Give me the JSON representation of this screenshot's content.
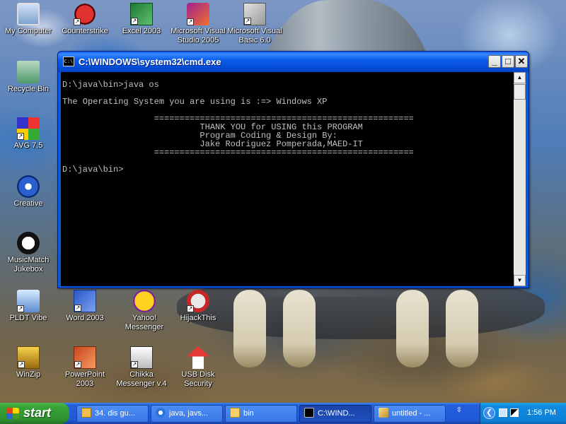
{
  "desktop": {
    "icons": [
      {
        "label": "My Computer",
        "icon": "my-computer-icon"
      },
      {
        "label": "Counterstrike",
        "icon": "counterstrike-icon"
      },
      {
        "label": "Excel 2003",
        "icon": "excel-icon"
      },
      {
        "label": "Microsoft Visual Studio 2005",
        "icon": "visual-studio-icon"
      },
      {
        "label": "Microsoft Visual Basic 6.0",
        "icon": "visual-basic-icon"
      },
      {
        "label": "Recycle Bin",
        "icon": "recycle-bin-icon"
      },
      {
        "label": "AVG 7.5",
        "icon": "avg-icon"
      },
      {
        "label": "Creative",
        "icon": "creative-icon"
      },
      {
        "label": "MusicMatch Jukebox",
        "icon": "musicmatch-icon"
      },
      {
        "label": "PLDT Vibe",
        "icon": "pldt-vibe-icon"
      },
      {
        "label": "Word 2003",
        "icon": "word-icon"
      },
      {
        "label": "Yahoo! Messenger",
        "icon": "yahoo-messenger-icon"
      },
      {
        "label": "HijackThis",
        "icon": "hijackthis-icon"
      },
      {
        "label": "WinZip",
        "icon": "winzip-icon"
      },
      {
        "label": "PowerPoint 2003",
        "icon": "powerpoint-icon"
      },
      {
        "label": "Chikka Messenger v.4",
        "icon": "chikka-icon"
      },
      {
        "label": "USB Disk Security",
        "icon": "usb-disk-security-icon"
      }
    ]
  },
  "window": {
    "title": "C:\\WINDOWS\\system32\\cmd.exe",
    "app_icon_text": "C:\\",
    "minimize": "_",
    "maximize": "□",
    "close": "✕"
  },
  "console": {
    "lines": [
      "D:\\java\\bin>java os",
      "",
      "The Operating System you are using is :=> Windows XP",
      "",
      "                  ===================================================",
      "                           THANK YOU for USING this PROGRAM",
      "                           Program Coding & Design By:",
      "                           Jake Rodriguez Pomperada,MAED-IT",
      "                  ===================================================",
      "",
      "D:\\java\\bin>"
    ]
  },
  "taskbar": {
    "start_label": "start",
    "tasks": [
      {
        "label": "34. dis gu...",
        "icon": "document-icon",
        "active": false
      },
      {
        "label": "java, javs...",
        "icon": "internet-explorer-icon",
        "active": false
      },
      {
        "label": "bin",
        "icon": "folder-icon",
        "active": false
      },
      {
        "label": "C:\\WIND...",
        "icon": "cmd-icon",
        "active": true
      },
      {
        "label": "untitled - ...",
        "icon": "paint-icon",
        "active": false
      }
    ],
    "tray_toggle": "⇳",
    "clock": "1:56 PM"
  },
  "colors": {
    "titlebar": "#0a58e0",
    "taskbar": "#245edb",
    "start_button": "#37a537",
    "tray": "#0f80d6",
    "console_bg": "#000000",
    "console_fg": "#c0c0c0"
  }
}
